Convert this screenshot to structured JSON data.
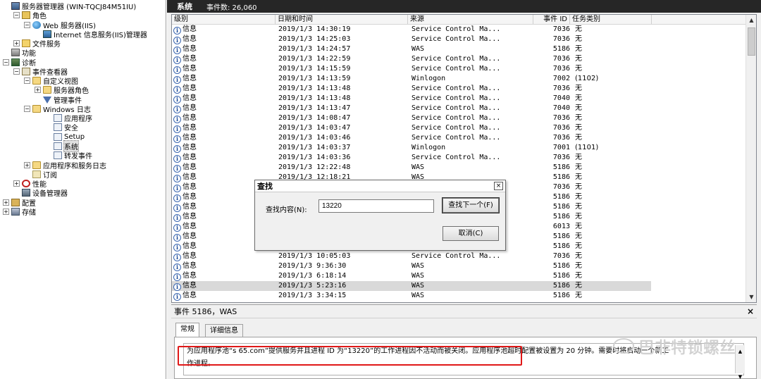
{
  "tree": {
    "items": [
      {
        "label": "服务器管理器 (WIN-TQCJ84M51IU)",
        "toggle": "",
        "icon": "server-manager-icon"
      },
      {
        "label": "角色",
        "toggle": "−",
        "icon": "roles-icon"
      },
      {
        "label": "Web 服务器(IIS)",
        "toggle": "−",
        "icon": "web-server-icon"
      },
      {
        "label": "Internet 信息服务(IIS)管理器",
        "toggle": "",
        "icon": "iis-manager-icon"
      },
      {
        "label": "文件服务",
        "toggle": "+",
        "icon": "file-services-icon"
      },
      {
        "label": "功能",
        "toggle": "",
        "icon": "features-icon"
      },
      {
        "label": "诊断",
        "toggle": "−",
        "icon": "diagnostics-icon"
      },
      {
        "label": "事件查看器",
        "toggle": "−",
        "icon": "event-viewer-icon"
      },
      {
        "label": "自定义视图",
        "toggle": "−",
        "icon": "folder-icon"
      },
      {
        "label": "服务器角色",
        "toggle": "+",
        "icon": "folder-icon"
      },
      {
        "label": "管理事件",
        "toggle": "",
        "icon": "filter-icon"
      },
      {
        "label": "Windows 日志",
        "toggle": "−",
        "icon": "folder-icon"
      },
      {
        "label": "应用程序",
        "toggle": "",
        "icon": "log-icon"
      },
      {
        "label": "安全",
        "toggle": "",
        "icon": "log-icon"
      },
      {
        "label": "Setup",
        "toggle": "",
        "icon": "log-icon"
      },
      {
        "label": "系统",
        "toggle": "",
        "icon": "log-icon"
      },
      {
        "label": "转发事件",
        "toggle": "",
        "icon": "log-icon"
      },
      {
        "label": "应用程序和服务日志",
        "toggle": "+",
        "icon": "folder-icon"
      },
      {
        "label": "订阅",
        "toggle": "",
        "icon": "subscriptions-icon"
      },
      {
        "label": "性能",
        "toggle": "+",
        "icon": "performance-icon"
      },
      {
        "label": "设备管理器",
        "toggle": "",
        "icon": "device-manager-icon"
      },
      {
        "label": "配置",
        "toggle": "+",
        "icon": "configuration-icon"
      },
      {
        "label": "存储",
        "toggle": "+",
        "icon": "storage-icon"
      }
    ]
  },
  "header": {
    "title": "系统",
    "count_label": "事件数: 26,060"
  },
  "grid": {
    "columns": [
      "级别",
      "日期和时间",
      "来源",
      "事件 ID",
      "任务类别"
    ],
    "rows": [
      {
        "level": "信息",
        "time": "2019/1/3 14:30:19",
        "source": "Service Control Ma...",
        "id": "7036",
        "cat": "无"
      },
      {
        "level": "信息",
        "time": "2019/1/3 14:25:03",
        "source": "Service Control Ma...",
        "id": "7036",
        "cat": "无"
      },
      {
        "level": "信息",
        "time": "2019/1/3 14:24:57",
        "source": "WAS",
        "id": "5186",
        "cat": "无"
      },
      {
        "level": "信息",
        "time": "2019/1/3 14:22:59",
        "source": "Service Control Ma...",
        "id": "7036",
        "cat": "无"
      },
      {
        "level": "信息",
        "time": "2019/1/3 14:15:59",
        "source": "Service Control Ma...",
        "id": "7036",
        "cat": "无"
      },
      {
        "level": "信息",
        "time": "2019/1/3 14:13:59",
        "source": "Winlogon",
        "id": "7002",
        "cat": "(1102)"
      },
      {
        "level": "信息",
        "time": "2019/1/3 14:13:48",
        "source": "Service Control Ma...",
        "id": "7036",
        "cat": "无"
      },
      {
        "level": "信息",
        "time": "2019/1/3 14:13:48",
        "source": "Service Control Ma...",
        "id": "7040",
        "cat": "无"
      },
      {
        "level": "信息",
        "time": "2019/1/3 14:13:47",
        "source": "Service Control Ma...",
        "id": "7040",
        "cat": "无"
      },
      {
        "level": "信息",
        "time": "2019/1/3 14:08:47",
        "source": "Service Control Ma...",
        "id": "7036",
        "cat": "无"
      },
      {
        "level": "信息",
        "time": "2019/1/3 14:03:47",
        "source": "Service Control Ma...",
        "id": "7036",
        "cat": "无"
      },
      {
        "level": "信息",
        "time": "2019/1/3 14:03:46",
        "source": "Service Control Ma...",
        "id": "7036",
        "cat": "无"
      },
      {
        "level": "信息",
        "time": "2019/1/3 14:03:37",
        "source": "Winlogon",
        "id": "7001",
        "cat": "(1101)"
      },
      {
        "level": "信息",
        "time": "2019/1/3 14:03:36",
        "source": "Service Control Ma...",
        "id": "7036",
        "cat": "无"
      },
      {
        "level": "信息",
        "time": "2019/1/3 12:22:48",
        "source": "WAS",
        "id": "5186",
        "cat": "无"
      },
      {
        "level": "信息",
        "time": "2019/1/3 12:18:21",
        "source": "WAS",
        "id": "5186",
        "cat": "无"
      },
      {
        "level": "信息",
        "time": "",
        "source": "",
        "id": "7036",
        "cat": "无"
      },
      {
        "level": "信息",
        "time": "",
        "source": "",
        "id": "5186",
        "cat": "无"
      },
      {
        "level": "信息",
        "time": "",
        "source": "",
        "id": "5186",
        "cat": "无"
      },
      {
        "level": "信息",
        "time": "",
        "source": "",
        "id": "5186",
        "cat": "无"
      },
      {
        "level": "信息",
        "time": "",
        "source": "",
        "id": "6013",
        "cat": "无"
      },
      {
        "level": "信息",
        "time": "",
        "source": "",
        "id": "5186",
        "cat": "无"
      },
      {
        "level": "信息",
        "time": "",
        "source": "",
        "id": "5186",
        "cat": "无"
      },
      {
        "level": "信息",
        "time": "2019/1/3 10:05:03",
        "source": "Service Control Ma...",
        "id": "7036",
        "cat": "无"
      },
      {
        "level": "信息",
        "time": "2019/1/3 9:36:30",
        "source": "WAS",
        "id": "5186",
        "cat": "无"
      },
      {
        "level": "信息",
        "time": "2019/1/3 6:18:14",
        "source": "WAS",
        "id": "5186",
        "cat": "无"
      },
      {
        "level": "信息",
        "time": "2019/1/3 5:23:16",
        "source": "WAS",
        "id": "5186",
        "cat": "无"
      },
      {
        "level": "信息",
        "time": "2019/1/3 3:34:15",
        "source": "WAS",
        "id": "5186",
        "cat": "无"
      }
    ],
    "selected_row": 26
  },
  "detail": {
    "title": "事件 5186，WAS",
    "close": "×",
    "tabs": [
      "常规",
      "详细信息"
    ],
    "message_line1": "为应用程序池“s                  65.com”提供服务并且进程 ID 为“13220”的工作进程因不活动而被关闭。应用程序池超时配置被设置为 20 分钟。需要时将启动一个新工",
    "message_line2": "作进程。"
  },
  "find_dialog": {
    "title": "查找",
    "close": "×",
    "label": "查找内容(N):",
    "value": "13220",
    "next_button": "查找下一个(F)",
    "cancel_button": "取消(C)"
  },
  "watermark": {
    "text": "巴非特锁螺丝"
  },
  "icons": {
    "info": "i",
    "scroll_up": "▲",
    "scroll_down": "▼"
  }
}
